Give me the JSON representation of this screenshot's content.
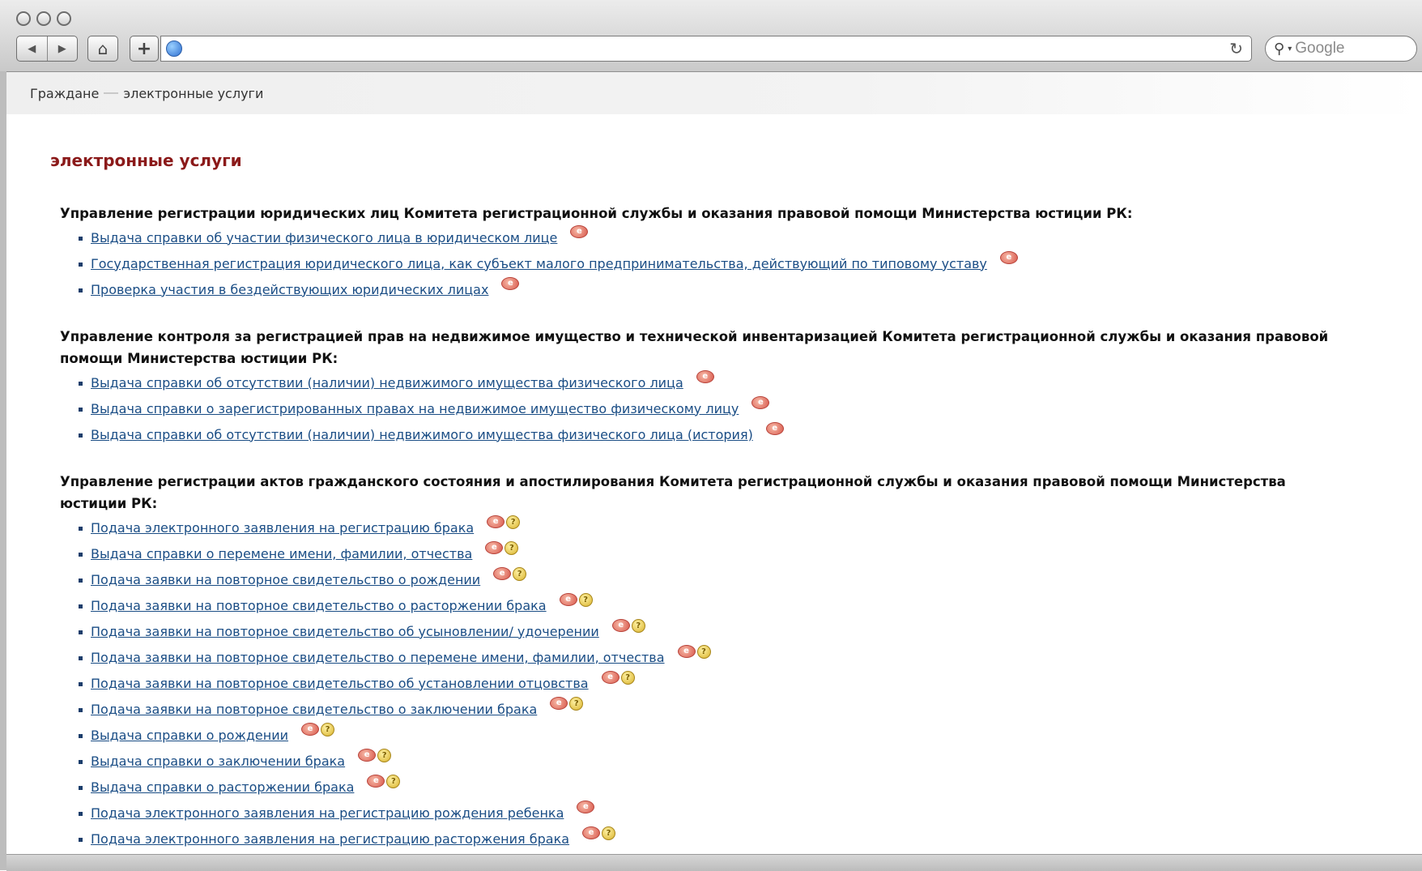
{
  "browser": {
    "search_placeholder": "Google",
    "icons": {
      "back": "back-arrow-icon",
      "forward": "forward-arrow-icon",
      "home": "home-icon",
      "add": "plus-icon",
      "site": "globe-icon",
      "reload": "reload-icon",
      "search": "search-icon"
    }
  },
  "breadcrumb": {
    "items": [
      "Граждане",
      "электронные услуги"
    ]
  },
  "page": {
    "title": "электронные услуги",
    "title_color": "#8b1a1a",
    "link_color": "#1a4d85"
  },
  "sections": [
    {
      "heading": "Управление регистрации юридических лиц Комитета регистрационной службы и оказания правовой помощи Министерства юстиции РК:",
      "services": [
        {
          "label": "Выдача справки об участии физического лица в юридическом лице",
          "icons": [
            "e-service-icon"
          ]
        },
        {
          "label": "Государственная регистрация юридического лица, как субъект малого предпринимательства, действующий по типовому уставу",
          "icons": [
            "e-service-icon"
          ]
        },
        {
          "label": "Проверка участия в бездействующих юридических лицах",
          "icons": [
            "e-service-icon"
          ]
        }
      ]
    },
    {
      "heading": "Управление контроля за регистрацией прав на недвижимое имущество и технической инвентаризацией Комитета регистрационной службы и оказания правовой помощи Министерства юстиции РК:",
      "services": [
        {
          "label": "Выдача справки об отсутствии (наличии) недвижимого имущества физического лица",
          "icons": [
            "e-service-icon"
          ]
        },
        {
          "label": "Выдача справки о зарегистрированных правах на недвижимое имущество физическому лицу",
          "icons": [
            "e-service-icon"
          ]
        },
        {
          "label": "Выдача справки об отсутствии (наличии) недвижимого имущества физического лица (история)",
          "icons": [
            "e-service-icon"
          ]
        }
      ]
    },
    {
      "heading": "Управление регистрации актов гражданского состояния и апостилирования Комитета регистрационной службы и оказания правовой помощи Министерства юстиции РК:",
      "services": [
        {
          "label": "Подача электронного заявления на регистрацию брака",
          "icons": [
            "e-service-icon",
            "info-icon"
          ]
        },
        {
          "label": "Выдача справки о перемене имени, фамилии, отчества",
          "icons": [
            "e-service-icon",
            "info-icon"
          ]
        },
        {
          "label": "Подача заявки на повторное свидетельство о рождении",
          "icons": [
            "e-service-icon",
            "info-icon"
          ]
        },
        {
          "label": "Подача заявки на повторное свидетельство о расторжении брака",
          "icons": [
            "e-service-icon",
            "info-icon"
          ]
        },
        {
          "label": "Подача заявки на повторное свидетельство об усыновлении/ удочерении",
          "icons": [
            "e-service-icon",
            "info-icon"
          ]
        },
        {
          "label": "Подача заявки на повторное свидетельство о перемене имени, фамилии, отчества",
          "icons": [
            "e-service-icon",
            "info-icon"
          ]
        },
        {
          "label": "Подача заявки на повторное свидетельство об установлении отцовства",
          "icons": [
            "e-service-icon",
            "info-icon"
          ]
        },
        {
          "label": "Подача заявки на повторное свидетельство о заключении брака",
          "icons": [
            "e-service-icon",
            "info-icon"
          ]
        },
        {
          "label": "Выдача справки о рождении",
          "icons": [
            "e-service-icon",
            "info-icon"
          ]
        },
        {
          "label": "Выдача справки о заключении брака",
          "icons": [
            "e-service-icon",
            "info-icon"
          ]
        },
        {
          "label": "Выдача справки о расторжении брака",
          "icons": [
            "e-service-icon",
            "info-icon"
          ]
        },
        {
          "label": "Подача электронного заявления на регистрацию рождения ребенка",
          "icons": [
            "e-service-icon"
          ]
        },
        {
          "label": "Подача электронного заявления на регистрацию расторжения брака",
          "icons": [
            "e-service-icon",
            "info-icon"
          ]
        }
      ]
    }
  ]
}
